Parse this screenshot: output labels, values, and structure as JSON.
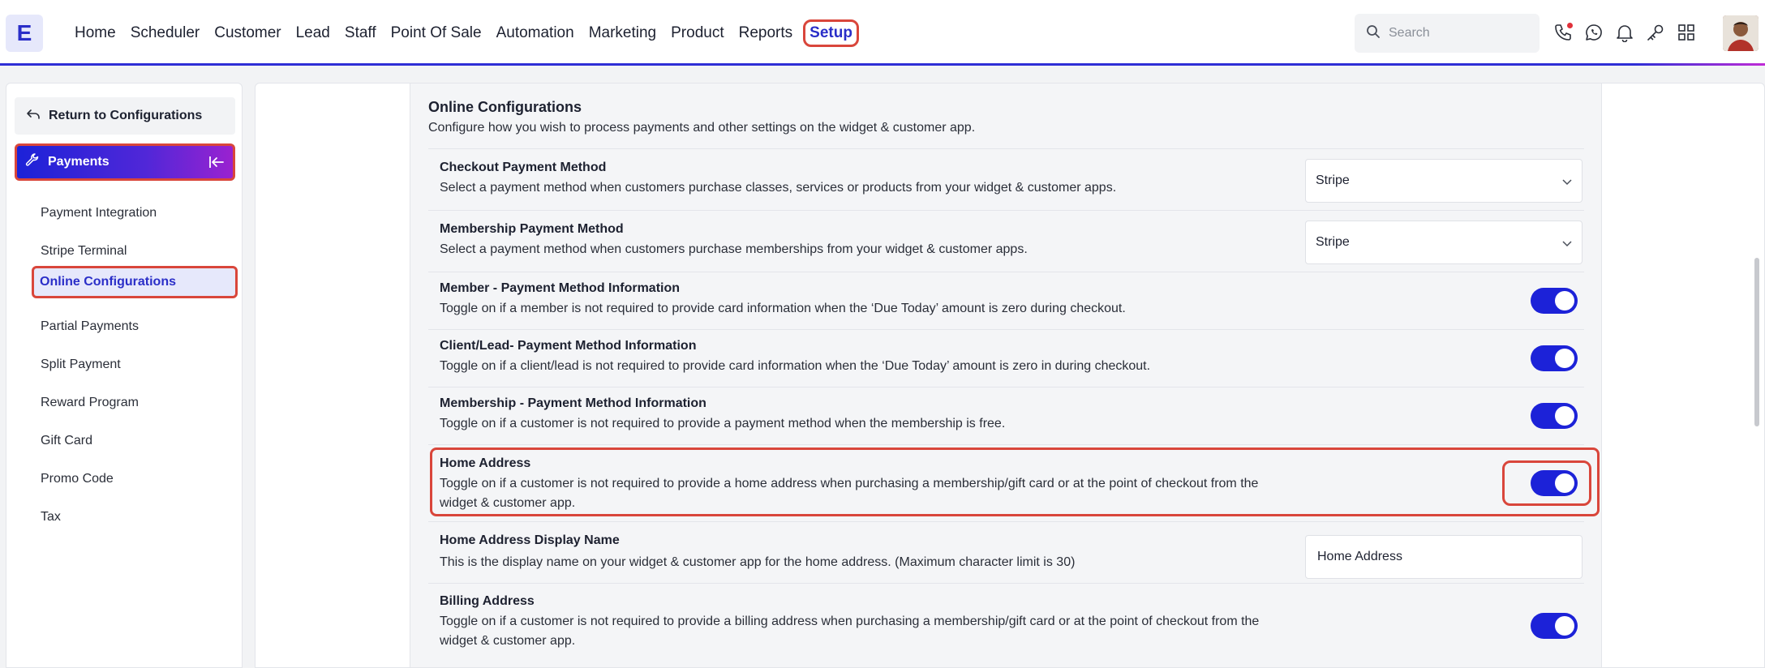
{
  "app": {
    "logo_letter": "E"
  },
  "nav": {
    "items": [
      "Home",
      "Scheduler",
      "Customer",
      "Lead",
      "Staff",
      "Point Of Sale",
      "Automation",
      "Marketing",
      "Product",
      "Reports"
    ],
    "active": "Setup"
  },
  "search": {
    "placeholder": "Search"
  },
  "top_icons": [
    "phone-icon",
    "whatsapp-icon",
    "bell-icon",
    "key-icon",
    "grid-icon"
  ],
  "sidebar": {
    "return_label": "Return to Configurations",
    "section_label": "Payments",
    "items": [
      "Payment Integration",
      "Stripe Terminal",
      "Online Configurations",
      "Partial Payments",
      "Split Payment",
      "Reward Program",
      "Gift Card",
      "Promo Code",
      "Tax"
    ],
    "active_item": "Online Configurations"
  },
  "panel": {
    "title": "Online Configurations",
    "description": "Configure how you wish to process payments and other settings on the widget & customer app.",
    "rows": [
      {
        "title": "Checkout Payment Method",
        "desc": "Select a payment method when customers purchase classes, services or products from your widget & customer apps.",
        "control": "select",
        "value": "Stripe"
      },
      {
        "title": "Membership Payment Method",
        "desc": "Select a payment method when customers purchase memberships from your widget & customer apps.",
        "control": "select",
        "value": "Stripe"
      },
      {
        "title": "Member - Payment Method Information",
        "desc": "Toggle on if a member is not required to provide card information when the ‘Due Today’ amount is zero during checkout.",
        "control": "toggle",
        "value": "on"
      },
      {
        "title": "Client/Lead- Payment Method Information",
        "desc": "Toggle on if a client/lead is not required to provide card information when the ‘Due Today’ amount is zero in during checkout.",
        "control": "toggle",
        "value": "on"
      },
      {
        "title": "Membership - Payment Method Information",
        "desc": "Toggle on if a customer is not required to provide a payment method when the membership is free.",
        "control": "toggle",
        "value": "on"
      },
      {
        "title": "Home Address",
        "desc": "Toggle on if a customer is not required to provide a home address when purchasing a membership/gift card or at the point of checkout from the widget & customer app.",
        "control": "toggle",
        "value": "on"
      },
      {
        "title": "Home Address Display Name",
        "desc": "This is the display name on your widget & customer app for the home address. (Maximum character limit is 30)",
        "control": "input",
        "value": "Home Address"
      },
      {
        "title": "Billing Address",
        "desc": "Toggle on if a customer is not required to provide a billing address when purchasing a membership/gift card or at the point of checkout from the widget & customer app.",
        "control": "toggle",
        "value": "on"
      }
    ]
  },
  "colors": {
    "accent": "#1c22d8",
    "highlight": "#d9463b"
  }
}
